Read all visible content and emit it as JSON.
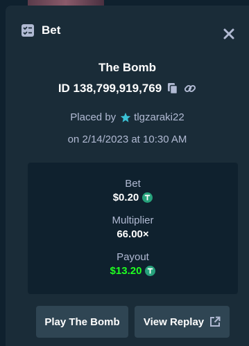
{
  "modal": {
    "title": "Bet",
    "title_icon": "bet-slip-icon",
    "close_icon": "close-icon"
  },
  "bet": {
    "game": "The Bomb",
    "id_text": "ID 138,799,919,769",
    "copy_icon": "copy-icon",
    "link_icon": "link-icon",
    "placed_by_label": "Placed by",
    "user_icon": "vip-star-icon",
    "username": "tlgzaraki22",
    "placed_on": "on 2/14/2023 at 10:30 AM"
  },
  "stats": {
    "bet_label": "Bet",
    "bet_value": "$0.20",
    "multiplier_label": "Multiplier",
    "multiplier_value": "66.00×",
    "payout_label": "Payout",
    "payout_value": "$13.20",
    "currency_icon": "tether-coin-icon"
  },
  "buttons": {
    "play_label": "Play The Bomb",
    "replay_label": "View Replay",
    "replay_icon": "external-link-icon"
  },
  "colors": {
    "background": "#0f212e",
    "panel": "#1a2c38",
    "button": "#2f4553",
    "payout_green": "#1fff20",
    "tether": "#26a17b",
    "star": "#3bc2d6"
  }
}
